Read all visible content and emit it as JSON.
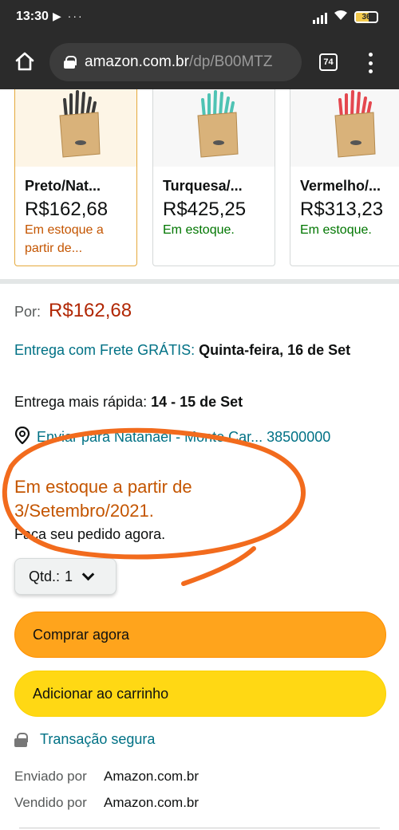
{
  "status_bar": {
    "time": "13:30",
    "left_icons": "▶ ···",
    "battery": "36"
  },
  "browser": {
    "url_host": "amazon.com.br",
    "url_path": "/dp/B00MTZ",
    "tab_count": "74"
  },
  "variants": [
    {
      "name": "Preto/Nat...",
      "price": "R$162,68",
      "stock": "Em estoque a partir de...",
      "selected": true
    },
    {
      "name": "Turquesa/...",
      "price": "R$425,25",
      "stock": "Em estoque."
    },
    {
      "name": "Vermelho/...",
      "price": "R$313,23",
      "stock": "Em estoque."
    }
  ],
  "price": {
    "label": "Por:",
    "value": "R$162,68"
  },
  "delivery": {
    "link": "Entrega com Frete GRÁTIS:",
    "date": "Quinta-feira, 16 de Set"
  },
  "fast_delivery": {
    "label": "Entrega mais rápida:",
    "date": "14 - 15 de Set"
  },
  "location": {
    "text": "Enviar para Natanael - Monte Car... 38500000"
  },
  "availability": {
    "text": "Em estoque a partir de 3/Setembro/2021.",
    "order_now": "Faça seu pedido agora."
  },
  "quantity": {
    "label": "Qtd.:",
    "value": "1"
  },
  "buttons": {
    "buy_now": "Comprar agora",
    "add_to_cart": "Adicionar ao carrinho"
  },
  "secure": {
    "text": "Transação segura"
  },
  "seller": {
    "shipped_by_label": "Enviado por",
    "shipped_by_value": "Amazon.com.br",
    "sold_by_label": "Vendido por",
    "sold_by_value": "Amazon.com.br"
  },
  "colors": {
    "price_red": "#b12704",
    "availability_orange": "#c45500",
    "link_teal": "#007185",
    "buy_now": "#ffa41c",
    "add_to_cart": "#ffd814",
    "annotation_circle": "#f26b1d"
  },
  "icons": [
    "home-icon",
    "lock-icon",
    "tabs-icon",
    "menu-icon",
    "location-pin-icon",
    "chevron-down-icon",
    "secure-lock-icon"
  ]
}
